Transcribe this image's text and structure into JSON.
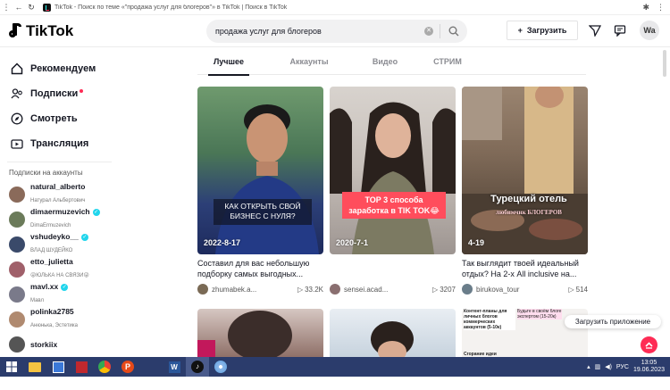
{
  "browser": {
    "url_text": "TikTok - Поиск по теме «\"продажа услуг для блогеров\"» в TikTok | Поиск в TikTok"
  },
  "header": {
    "logo_text": "TikTok",
    "search_query": "продажа услуг для блогеров",
    "upload_label": "Загрузить",
    "avatar_initials": "Wa"
  },
  "sidebar": {
    "nav": [
      {
        "label": "Рекомендуем",
        "icon": "home-icon"
      },
      {
        "label": "Подписки",
        "icon": "following-icon"
      },
      {
        "label": "Смотреть",
        "icon": "explore-icon"
      },
      {
        "label": "Трансляция",
        "icon": "live-icon"
      }
    ],
    "following_title": "Подписки на аккаунты",
    "accounts": [
      {
        "name": "natural_alberto",
        "sub": "Натурал Альбертович",
        "verified": false,
        "color": "#8a6a5a"
      },
      {
        "name": "dimaermuzevich",
        "sub": "DimaErmuzevich",
        "verified": true,
        "color": "#6b7b5a"
      },
      {
        "name": "vshudeyko__",
        "sub": "ВЛАД ШУДЕЙКО",
        "verified": true,
        "color": "#3a4a6a"
      },
      {
        "name": "etto_julietta",
        "sub": "😜ЮЛЬКА НА СВЯЗИ😜",
        "verified": false,
        "color": "#a0606a"
      },
      {
        "name": "mavl.xx",
        "sub": "Мавл",
        "verified": true,
        "color": "#7a7a8a"
      },
      {
        "name": "polinka2785",
        "sub": "Анюнька, Эстетика",
        "verified": false,
        "color": "#b08a70"
      },
      {
        "name": "storkiix",
        "sub": "",
        "verified": false,
        "color": "#555"
      }
    ]
  },
  "tabs": [
    "Лучшее",
    "Аккаунты",
    "Видео",
    "СТРИМ"
  ],
  "videos": [
    {
      "date": "2022-8-17",
      "overlay": "КАК ОТКРЫТЬ СВОЙ БИЗНЕС С НУЛЯ?",
      "caption": "Составил для вас небольшую подборку самых выгодных...",
      "author": "zhumabek.a...",
      "plays": "33.2K"
    },
    {
      "date": "2020-7-1",
      "overlay": "TOP 3 способа заработка в TIK TOK😂",
      "caption": "",
      "author": "sensei.acad...",
      "plays": "3207"
    },
    {
      "date": "4-19",
      "overlay": "Турецкий отель",
      "overlay_sub": "любимчик БЛОГЕРОВ",
      "caption": "Так выглядит твоей идеальный отдых? На 2-х All inclusive на...",
      "author": "birukova_tour",
      "plays": "514"
    }
  ],
  "row2": {
    "third_text": "Контент-планы для личных блогов коммерческих аккаунтов (5-10к)",
    "third_text2": "Сгорание идеи",
    "third_right": "Будьте в своём блоге экспертом (15-20к)"
  },
  "toast": "Загрузить приложение",
  "taskbar": {
    "lang": "РУС",
    "time": "13:05",
    "date": "19.06.2023"
  },
  "colors": {
    "accent": "#fe2c55",
    "verified": "#20d5ec",
    "taskbar": "#2b3c6c"
  }
}
